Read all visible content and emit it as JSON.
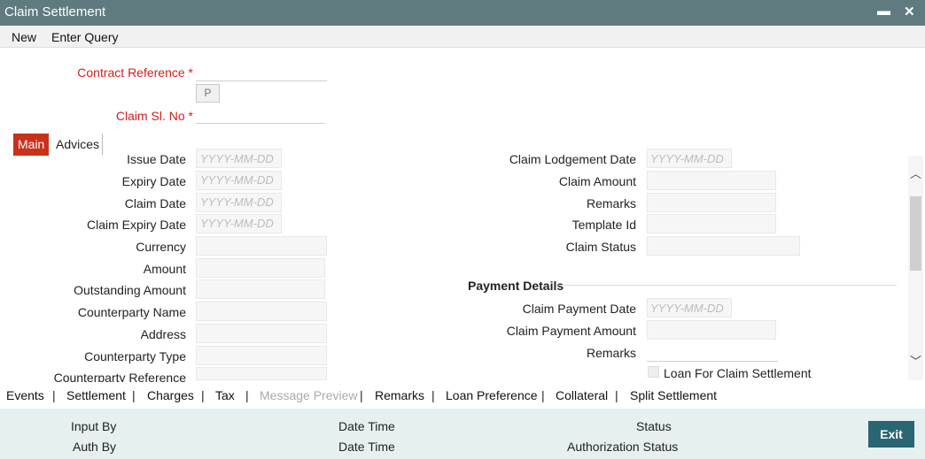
{
  "window": {
    "title": "Claim Settlement",
    "minimize": "▬",
    "close": "✕"
  },
  "menu": {
    "new": "New",
    "enter_query": "Enter Query"
  },
  "header": {
    "contract_reference_label": "Contract Reference *",
    "p_button": "P",
    "claim_sl_no_label": "Claim Sl. No *"
  },
  "tabs": {
    "main": "Main",
    "advices": "Advices"
  },
  "date_placeholder": "YYYY-MM-DD",
  "left_fields": {
    "issue_date": "Issue Date",
    "expiry_date": "Expiry Date",
    "claim_date": "Claim Date",
    "claim_expiry_date": "Claim Expiry Date",
    "currency": "Currency",
    "amount": "Amount",
    "outstanding_amount": "Outstanding Amount",
    "counterparty_name": "Counterparty Name",
    "address": "Address",
    "counterparty_type": "Counterparty Type",
    "counterparty_reference": "Counterparty Reference"
  },
  "right_fields": {
    "claim_lodgement_date": "Claim Lodgement Date",
    "claim_amount": "Claim Amount",
    "remarks": "Remarks",
    "template_id": "Template Id",
    "claim_status": "Claim Status"
  },
  "payment_details": {
    "title": "Payment Details",
    "claim_payment_date": "Claim Payment Date",
    "claim_payment_amount": "Claim Payment Amount",
    "remarks": "Remarks",
    "loan_for_claim_settlement": "Loan For Claim Settlement"
  },
  "bottom_links": {
    "events": "Events",
    "settlement": "Settlement",
    "charges": "Charges",
    "tax": "Tax",
    "message_preview": "Message Preview",
    "remarks": "Remarks",
    "loan_preference": "Loan Preference",
    "collateral": "Collateral",
    "split_settlement": "Split Settlement",
    "separator": "|"
  },
  "footer": {
    "input_by": "Input By",
    "date_time_1": "Date Time",
    "status": "Status",
    "auth_by": "Auth By",
    "date_time_2": "Date Time",
    "authorization_status": "Authorization Status",
    "exit": "Exit"
  },
  "colors": {
    "title_bar": "#5f7b80",
    "active_tab": "#c9311a",
    "required_label": "#d21f1f",
    "exit_button": "#2a6574",
    "footer_bg": "#e6f0f1"
  }
}
